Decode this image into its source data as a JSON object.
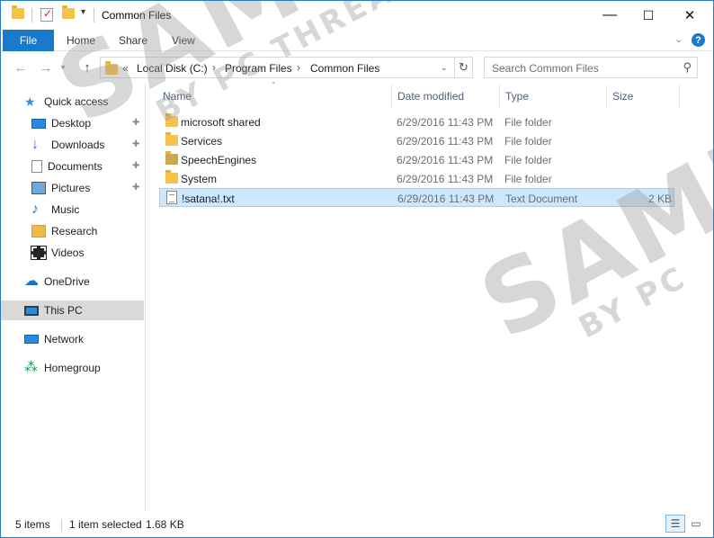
{
  "window": {
    "title": "Common Files",
    "controls": {
      "minimize": "—",
      "maximize": "☐",
      "close": "✕"
    }
  },
  "ribbon": {
    "tabs": [
      {
        "label": "File",
        "active": true
      },
      {
        "label": "Home"
      },
      {
        "label": "Share"
      },
      {
        "label": "View"
      }
    ],
    "expand_icon": "chevron-down",
    "help_label": "?"
  },
  "navigation": {
    "back_icon": "←",
    "forward_icon": "→",
    "recent_icon": "▾",
    "up_icon": "↑",
    "breadcrumb_prefix": "«",
    "breadcrumbs": [
      "Local Disk (C:)",
      "Program Files",
      "Common Files"
    ],
    "breadcrumb_sep": "›",
    "refresh_icon": "↻",
    "search_placeholder": "Search Common Files",
    "search_icon": "⚲"
  },
  "sidebar": {
    "items": [
      {
        "label": "Quick access",
        "icon": "star-icon",
        "pinned": false
      },
      {
        "label": "Desktop",
        "icon": "desktop-icon",
        "pinned": true
      },
      {
        "label": "Downloads",
        "icon": "download-icon",
        "pinned": true
      },
      {
        "label": "Documents",
        "icon": "document-icon",
        "pinned": true
      },
      {
        "label": "Pictures",
        "icon": "pictures-icon",
        "pinned": true
      },
      {
        "label": "Music",
        "icon": "music-icon",
        "pinned": false
      },
      {
        "label": "Research",
        "icon": "folder-icon",
        "pinned": false
      },
      {
        "label": "Videos",
        "icon": "video-icon",
        "pinned": false
      },
      {
        "label": "OneDrive",
        "icon": "cloud-icon",
        "pinned": false
      },
      {
        "label": "This PC",
        "icon": "computer-icon",
        "pinned": false,
        "selected": true
      },
      {
        "label": "Network",
        "icon": "network-icon",
        "pinned": false
      },
      {
        "label": "Homegroup",
        "icon": "homegroup-icon",
        "pinned": false
      }
    ],
    "pin_glyph": "📌"
  },
  "files": {
    "columns": [
      "Name",
      "Date modified",
      "Type",
      "Size"
    ],
    "rows": [
      {
        "name": "microsoft shared",
        "date": "6/29/2016 11:43 PM",
        "type": "File folder",
        "size": "",
        "kind": "folder"
      },
      {
        "name": "Services",
        "date": "6/29/2016 11:43 PM",
        "type": "File folder",
        "size": "",
        "kind": "folder"
      },
      {
        "name": "SpeechEngines",
        "date": "6/29/2016 11:43 PM",
        "type": "File folder",
        "size": "",
        "kind": "folder-dim"
      },
      {
        "name": "System",
        "date": "6/29/2016 11:43 PM",
        "type": "File folder",
        "size": "",
        "kind": "folder"
      },
      {
        "name": "!satana!.txt",
        "date": "6/29/2016 11:43 PM",
        "type": "Text Document",
        "size": "2 KB",
        "kind": "text",
        "selected": true
      }
    ]
  },
  "status": {
    "item_count": "5 items",
    "selection": "1 item selected",
    "selection_size": "1.68 KB"
  },
  "watermark": {
    "big": "SAMPLE",
    "small": "BY PC THREAT.COM",
    "big2": "SAMPLE",
    "small2": "BY PC"
  },
  "colors": {
    "accent": "#1979ca",
    "selection_bg": "#cce8ff",
    "selection_border": "#99d1ff",
    "folder": "#f5c34a"
  }
}
